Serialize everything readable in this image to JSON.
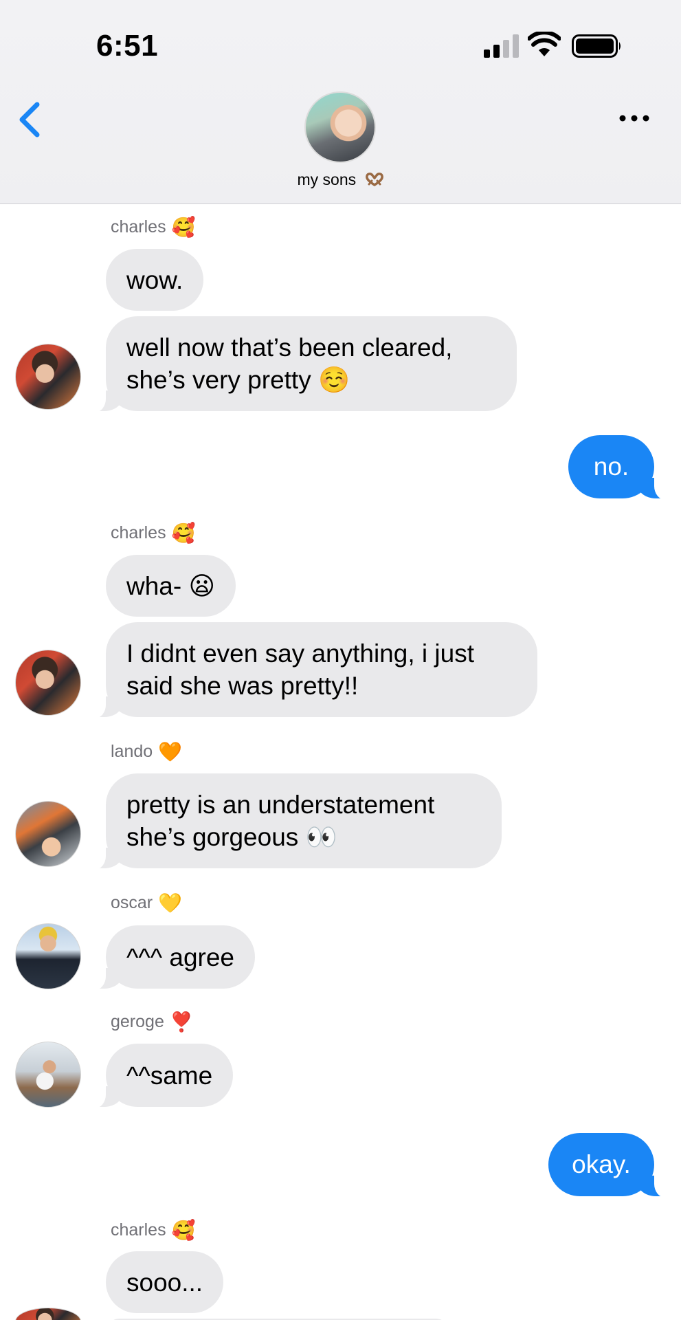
{
  "status_bar": {
    "time": "6:51"
  },
  "header": {
    "group_name": "my sons",
    "group_emoji": "heart-hands-emoji"
  },
  "messages": [
    {
      "sender": "charles",
      "sender_emoji": "🥰",
      "bubbles": [
        "wow.",
        "well now that’s been cleared,\nshe’s very pretty ☺️"
      ]
    },
    {
      "sender": "me",
      "bubbles": [
        "no."
      ]
    },
    {
      "sender": "charles",
      "sender_emoji": "🥰",
      "bubbles": [
        "wha- 😦",
        "I didnt even say anything, i just\nsaid she was pretty!!"
      ]
    },
    {
      "sender": "lando",
      "sender_emoji": "🧡",
      "bubbles": [
        "pretty is an understatement\nshe’s gorgeous 👀"
      ]
    },
    {
      "sender": "oscar",
      "sender_emoji": "💛",
      "bubbles": [
        "^^^ agree"
      ]
    },
    {
      "sender": "geroge",
      "sender_emoji": "❣️",
      "bubbles": [
        "^^same"
      ]
    },
    {
      "sender": "me",
      "bubbles": [
        "okay."
      ]
    },
    {
      "sender": "charles",
      "sender_emoji": "🥰",
      "bubbles": [
        "sooo..."
      ]
    }
  ],
  "colors": {
    "incoming_bubble": "#e9e9eb",
    "outgoing_bubble": "#1a86f5",
    "accent": "#1a86f5",
    "sender_label": "#707076"
  }
}
